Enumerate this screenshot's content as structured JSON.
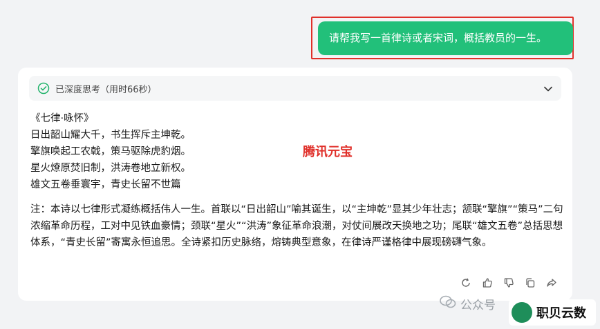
{
  "user_message": {
    "text": "请帮我写一首律诗或者宋词，概括教员的一生。"
  },
  "thinking": {
    "label": "已深度思考（用时66秒）"
  },
  "poem": {
    "title": "《七律·咏怀》",
    "lines": [
      "日出韶山耀大千，书生挥斥主坤乾。",
      "擎旗唤起工农戟，策马驱除虎豹烟。",
      "星火燎原焚旧制，洪涛卷地立新权。",
      "雄文五卷垂寰宇，青史长留不世篇"
    ]
  },
  "brand_tag": "腾讯元宝",
  "note": "注：本诗以七律形式凝练概括伟人一生。首联以“日出韶山”喻其诞生，以“主坤乾”显其少年壮志；颔联“擎旗”“策马”二句浓缩革命历程，工对中见铁血豪情；颈联“星火”“洪涛”象征革命浪潮，对仗间展改天换地之功；尾联“雄文五卷”总括思想体系，“青史长留”寄寓永恒追思。全诗紧扣历史脉络，熔铸典型意象，在律诗严谨格律中展现磅礴气象。",
  "actions": [
    "refresh-icon",
    "thumbs-up-icon",
    "thumbs-down-icon",
    "copy-icon",
    "share-icon"
  ],
  "watermark": {
    "text": "公众号",
    "logo_text": "职贝云数"
  },
  "colors": {
    "user_bubble": "#22c07a",
    "highlight": "#e0302a",
    "brand_tag": "#e0302a"
  }
}
